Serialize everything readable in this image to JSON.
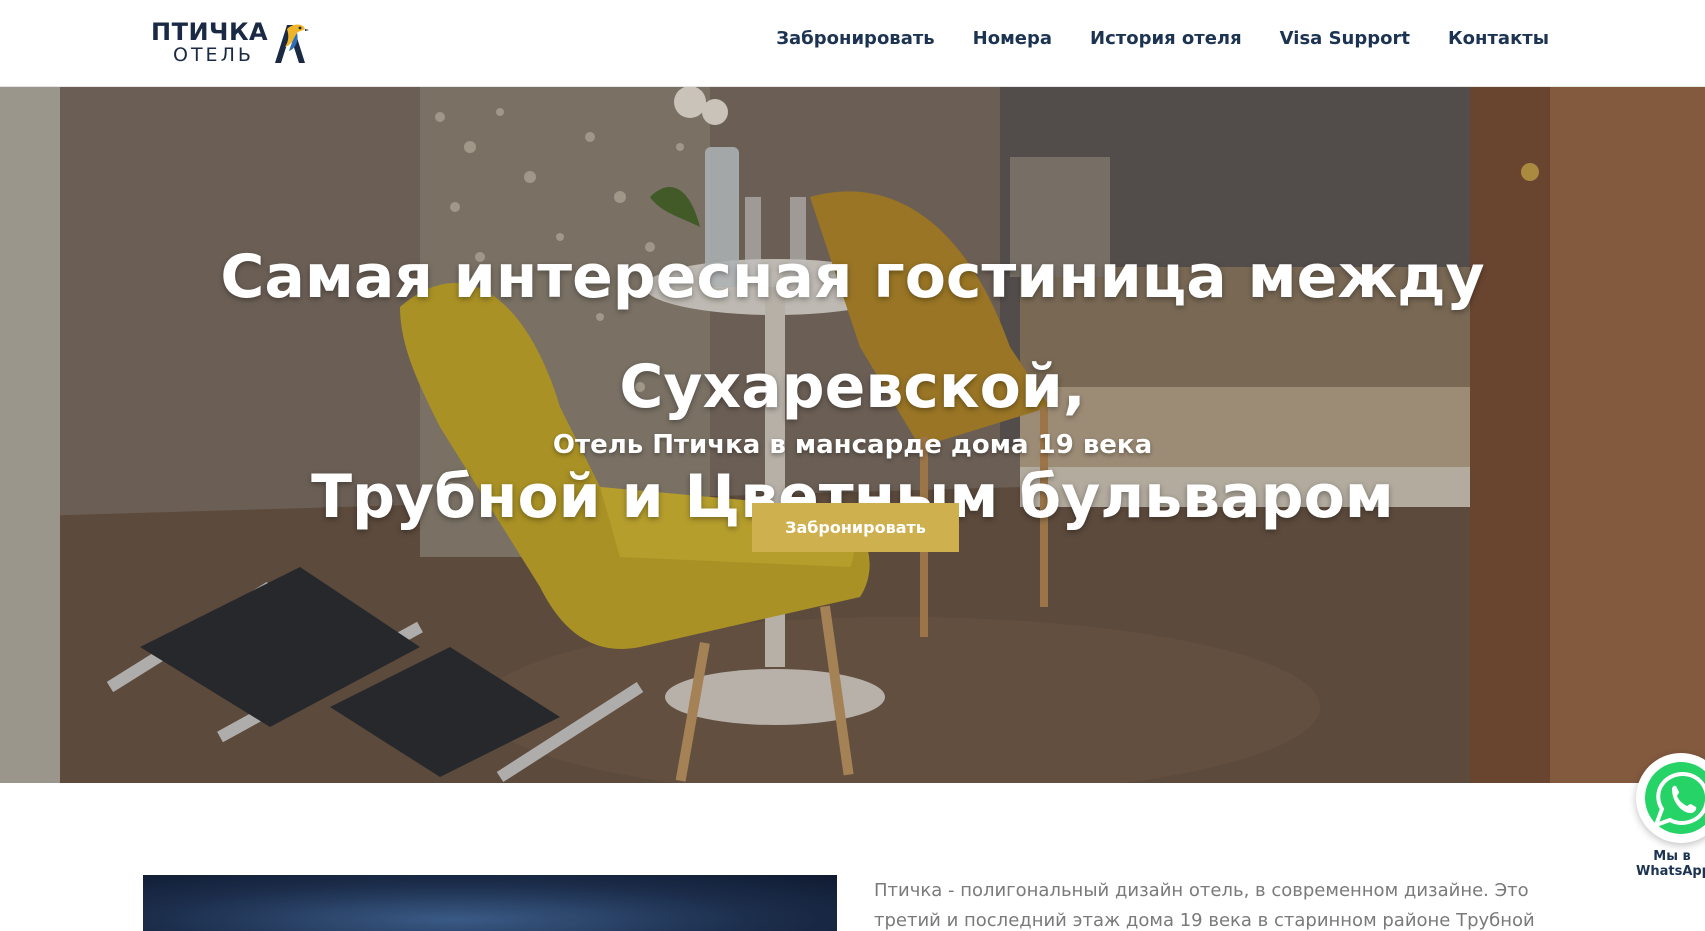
{
  "header": {
    "logo": {
      "line1": "ПТИЧКА",
      "line2": "ОТЕЛЬ"
    },
    "nav": [
      "Забронировать",
      "Номера",
      "История отеля",
      "Visa Support",
      "Контакты"
    ]
  },
  "hero": {
    "title_line1": "Самая интересная гостиница между Сухаревской,",
    "title_line2": "Трубной и Цветным бульваром",
    "subtitle": "Отель Птичка в мансарде дома 19 века",
    "cta": "Забронировать"
  },
  "about": {
    "text_line1": "Птичка - полигональный дизайн отель, в современном дизайне. Это",
    "text_line2": "третий и последний этаж дома 19 века в старинном районе Трубной"
  },
  "whatsapp": {
    "label_line1": "Мы в",
    "label_line2": "WhatsApp"
  },
  "colors": {
    "accent": "#cfb04e",
    "nav": "#1c3352",
    "whatsapp": "#25d366"
  }
}
